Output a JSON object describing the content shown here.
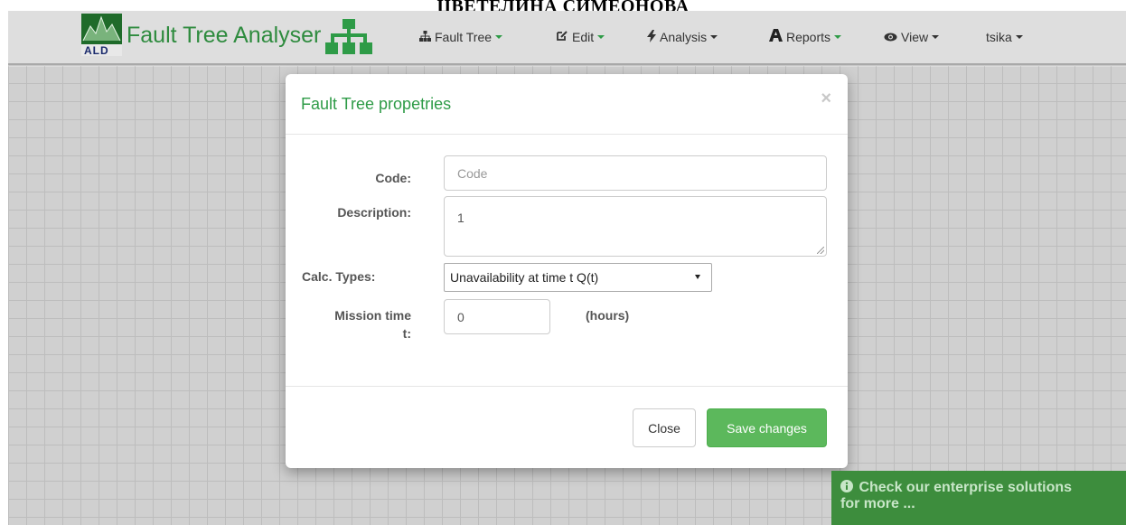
{
  "document": {
    "heading": "ЦВЕТЕЛИНА СИМЕОНОВА"
  },
  "navbar": {
    "logo_text": "ALD",
    "brand": "Fault Tree Analyser",
    "menus": [
      {
        "label": "Fault Tree",
        "icon": "sitemap-icon"
      },
      {
        "label": "Edit",
        "icon": "edit-icon"
      },
      {
        "label": "Analysis",
        "icon": "bolt-icon"
      },
      {
        "label": "Reports",
        "icon": "reports-icon"
      },
      {
        "label": "View",
        "icon": "eye-icon"
      },
      {
        "label": "tsika"
      }
    ]
  },
  "modal": {
    "title": "Fault Tree propetries",
    "close_symbol": "×",
    "fields": {
      "code_label": "Code:",
      "code_value": "",
      "code_placeholder": "Code",
      "description_label": "Description:",
      "description_value": "1",
      "calc_types_label": "Calc. Types:",
      "calc_types_value": "Unavailability at time t Q(t)",
      "mission_label_line1": "Mission time",
      "mission_label_line2": "t:",
      "mission_value": "0",
      "mission_units": "(hours)"
    },
    "buttons": {
      "close": "Close",
      "save": "Save changes"
    }
  },
  "enterprise_banner": {
    "line1": "Check our enterprise solutions",
    "line2": "for more ..."
  },
  "colors": {
    "brand_green": "#2e8b3e",
    "title_green": "#2e9b47",
    "save_button": "#5cb85c",
    "banner": "#3d8d3d"
  }
}
